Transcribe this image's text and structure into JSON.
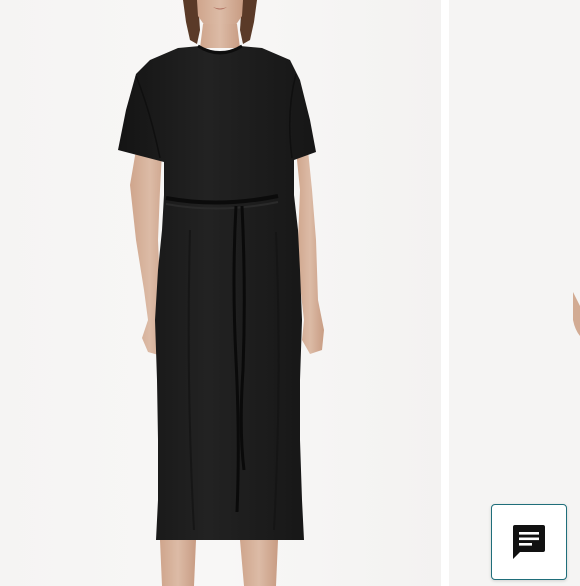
{
  "product_gallery": {
    "main_image_icon": "black-tshirt-dress-model-photo",
    "next_image_icon": "partial-model-photo"
  },
  "chat_widget": {
    "icon": "chat-bubble-icon",
    "accent_color": "#1f6e7a"
  },
  "colors": {
    "photo_background": "#f7f6f5",
    "dress": "#1c1c1c",
    "skin": "#d9b7a0"
  }
}
